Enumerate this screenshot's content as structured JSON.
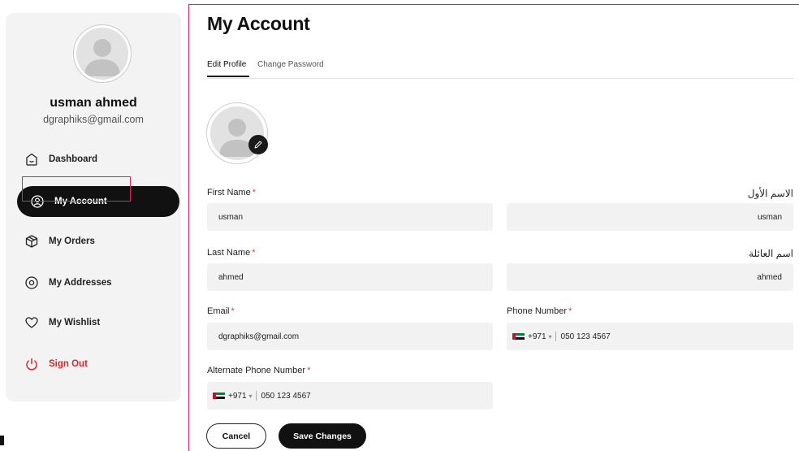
{
  "user": {
    "name": "usman ahmed",
    "email": "dgraphiks@gmail.com"
  },
  "sidebar": {
    "items": [
      {
        "label": "Dashboard",
        "icon": "home-icon"
      },
      {
        "label": "My Account",
        "icon": "user-circle-icon",
        "active": true
      },
      {
        "label": "My Orders",
        "icon": "box-icon"
      },
      {
        "label": "My Addresses",
        "icon": "location-pin-icon"
      },
      {
        "label": "My Wishlist",
        "icon": "heart-icon"
      },
      {
        "label": "Sign Out",
        "icon": "power-icon",
        "color": "#d62828"
      }
    ]
  },
  "main": {
    "title": "My Account",
    "tabs": [
      {
        "label": "Edit Profile",
        "active": true
      },
      {
        "label": "Change Password"
      }
    ]
  },
  "form": {
    "first_name": {
      "label": "First Name",
      "value": "usman",
      "label_ar": "الاسم الأول",
      "value_ar": "usman"
    },
    "last_name": {
      "label": "Last Name",
      "value": "ahmed",
      "label_ar": "اسم العائلة",
      "value_ar": "ahmed"
    },
    "email": {
      "label": "Email",
      "value": "dgraphiks@gmail.com"
    },
    "phone": {
      "label": "Phone Number",
      "country_code": "+971",
      "value": "050 123 4567"
    },
    "alt_phone": {
      "label": "Alternate Phone Number",
      "country_code": "+971",
      "value": "050 123 4567"
    },
    "required_mark": "*"
  },
  "actions": {
    "cancel_label": "Cancel",
    "save_label": "Save Changes"
  },
  "colors": {
    "accent": "#111111",
    "required": "#e23c3c",
    "signout": "#d62828",
    "field_bg": "#f2f2f2",
    "sidebar_bg": "#f3f3f3"
  }
}
